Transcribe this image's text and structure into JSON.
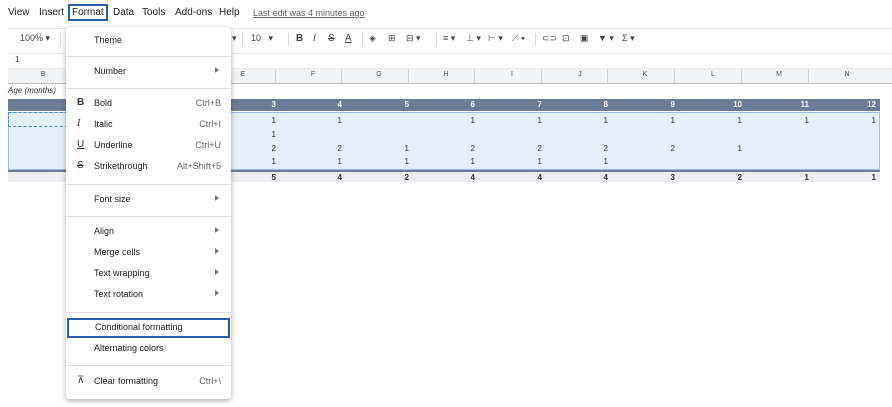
{
  "menubar": {
    "items": [
      "View",
      "Insert",
      "Format",
      "Data",
      "Tools",
      "Add-ons",
      "Help"
    ],
    "last_edit": "Last edit was 4 minutes ago"
  },
  "toolbar": {
    "zoom": "100%",
    "font_size": "10"
  },
  "formula_bar": {
    "value": "1"
  },
  "columns": [
    "B",
    "E",
    "F",
    "G",
    "H",
    "I",
    "J",
    "K",
    "L",
    "M",
    "N"
  ],
  "sheet": {
    "age_label": "Age (months)",
    "header_values": [
      "3",
      "4",
      "5",
      "6",
      "7",
      "8",
      "9",
      "10",
      "11",
      "12"
    ],
    "rows": [
      [
        "1",
        "1",
        "",
        "1",
        "1",
        "1",
        "1",
        "1",
        "1",
        "1"
      ],
      [
        "1",
        "",
        "",
        "",
        "",
        "",
        "",
        "",
        "",
        ""
      ],
      [
        "2",
        "2",
        "1",
        "2",
        "2",
        "2",
        "2",
        "1",
        "",
        ""
      ],
      [
        "1",
        "1",
        "1",
        "1",
        "1",
        "1",
        "",
        "",
        "",
        ""
      ]
    ],
    "totals": [
      "5",
      "4",
      "2",
      "4",
      "4",
      "4",
      "3",
      "2",
      "1",
      "1"
    ]
  },
  "format_menu": {
    "theme": "Theme",
    "number": "Number",
    "bold": "Bold",
    "bold_short": "Ctrl+B",
    "italic": "Italic",
    "italic_short": "Ctrl+I",
    "underline": "Underline",
    "underline_short": "Ctrl+U",
    "strike": "Strikethrough",
    "strike_short": "Alt+Shift+5",
    "font_size": "Font size",
    "align": "Align",
    "merge": "Merge cells",
    "wrap": "Text wrapping",
    "rotation": "Text rotation",
    "conditional": "Conditional formatting",
    "alternating": "Alternating colors",
    "clear": "Clear formatting",
    "clear_short": "Ctrl+\\"
  }
}
